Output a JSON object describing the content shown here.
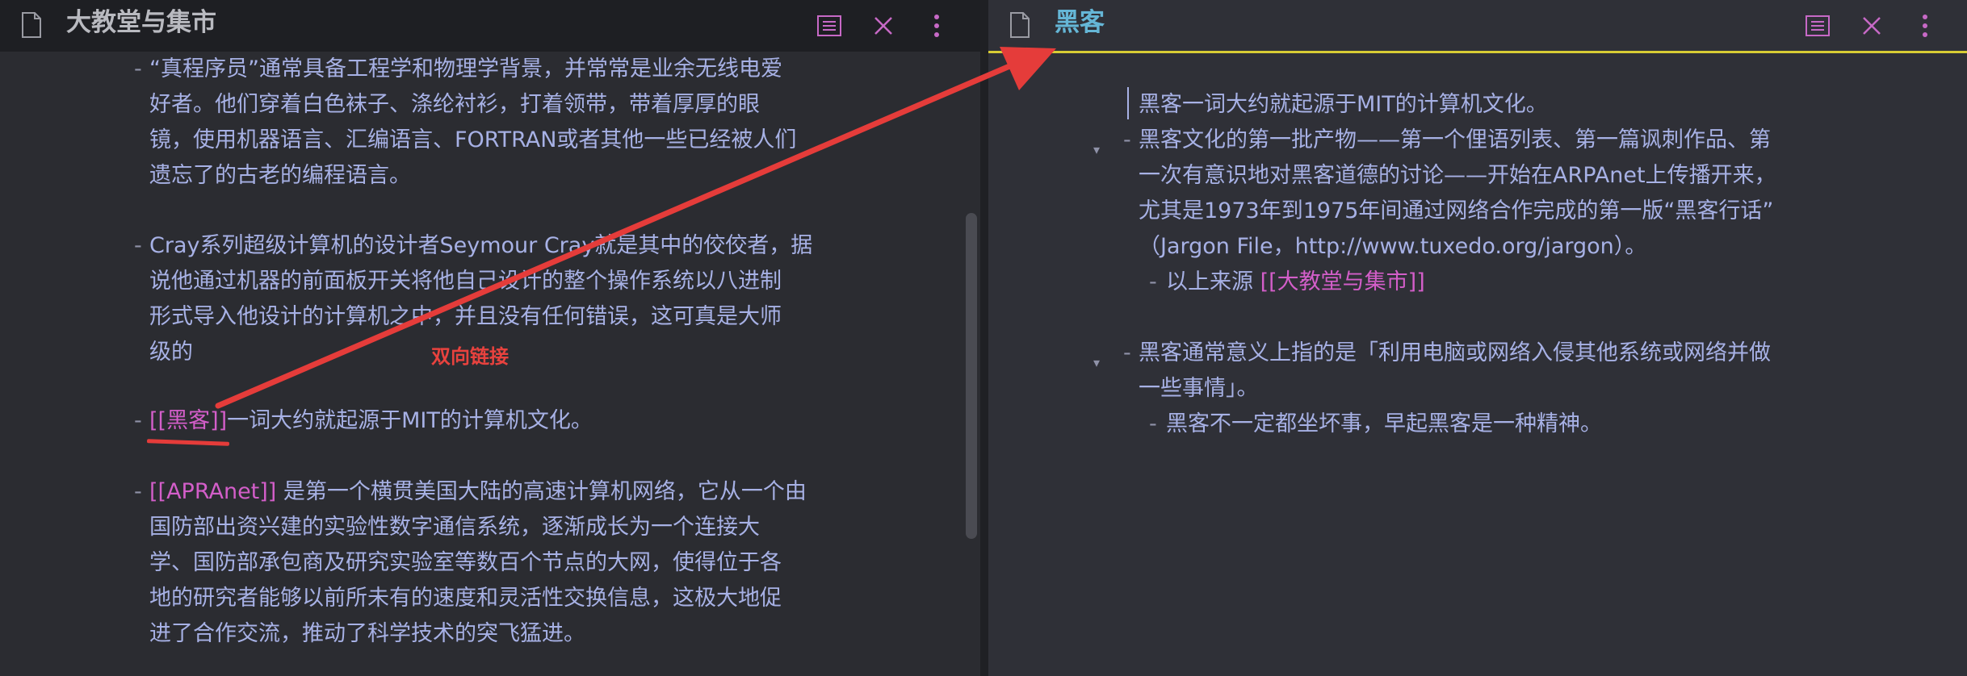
{
  "left_pane": {
    "title": "大教堂与集市",
    "icons": [
      "document-icon",
      "outline-icon",
      "close-icon",
      "more-icon"
    ],
    "blocks": [
      {
        "bullet": "-",
        "lines": [
          "“真程序员”通常具备工程学和物理学背景，并常常是业余无线电爱",
          "好者。他们穿着白色袜子、涤纶衬衫，打着领带，带着厚厚的眼",
          "镜，使用机器语言、汇编语言、FORTRAN或者其他一些已经被人们",
          "遗忘了的古老的编程语言。"
        ]
      },
      {
        "bullet": "-",
        "lines": [
          "Cray系列超级计算机的设计者Seymour Cray就是其中的佼佼者，据",
          "说他通过机器的前面板开关将他自己设计的整个操作系统以八进制",
          "形式导入他设计的计算机之中，并且没有任何错误，这可真是大师",
          "级的"
        ]
      },
      {
        "bullet": "-",
        "link": "[[黑客]]",
        "text": "一词大约就起源于MIT的计算机文化。"
      },
      {
        "bullet": "-",
        "link": "[[APRAnet]]",
        "first_text": " 是第一个横贯美国大陆的高速计算机网络，它从一个由",
        "lines": [
          "国防部出资兴建的实验性数字通信系统，逐渐成长为一个连接大",
          "学、国防部承包商及研究实验室等数百个节点的大网，使得位于各",
          "地的研究者能够以前所未有的速度和灵活性交换信息，这极大地促",
          "进了合作交流，推动了科学技术的突飞猛进。"
        ]
      }
    ]
  },
  "right_pane": {
    "title": "黑客",
    "icons": [
      "document-icon",
      "outline-icon",
      "close-icon",
      "more-icon"
    ],
    "blocks": [
      {
        "lines": [
          "黑客一词大约就起源于MIT的计算机文化。"
        ]
      },
      {
        "bullet": "-",
        "lines": [
          "黑客文化的第一批产物——第一个俚语列表、第一篇讽刺作品、第",
          "一次有意识地对黑客道德的讨论——开始在ARPAnet上传播开来，",
          "尤其是1973年到1975年间通过网络合作完成的第一版“黑客行话”",
          "（Jargon File，http://www.tuxedo.org/jargon）。"
        ],
        "child": {
          "bullet": "-",
          "text": "以上来源 ",
          "link": "[[大教堂与集市]]"
        }
      },
      {
        "bullet": "-",
        "lines": [
          "黑客通常意义上指的是「利用电脑或网络入侵其他系统或网络并做",
          "一些事情」。"
        ],
        "child": {
          "bullet": "-",
          "text": "黑客不一定都坐坏事，早起黑客是一种精神。"
        }
      }
    ],
    "fold_marker": "▾"
  },
  "annotation": {
    "label": "双向链接",
    "color": "#e53c3a"
  },
  "colors": {
    "body_text": "#a7b1e5",
    "link": "#d35ec9",
    "right_title": "#65b6d6",
    "left_title": "#b9bac0",
    "header_icon": "#c769c6",
    "active_border": "#d8cc34"
  }
}
